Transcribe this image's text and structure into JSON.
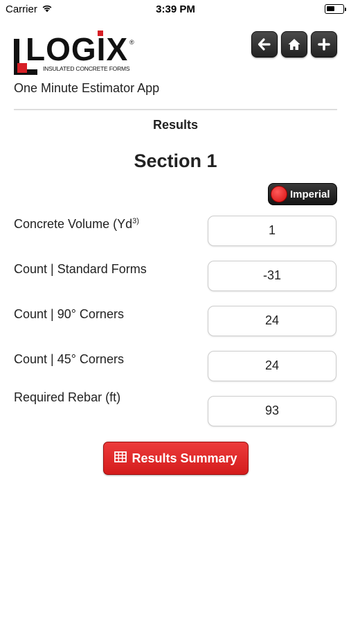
{
  "status_bar": {
    "carrier": "Carrier",
    "time": "3:39 PM"
  },
  "header": {
    "logo_text": "LOGIX",
    "logo_reg": "®",
    "logo_tagline": "INSULATED CONCRETE FORMS",
    "app_name": "One Minute Estimator App",
    "nav_icons": [
      "back-arrow-icon",
      "home-icon",
      "plus-icon"
    ]
  },
  "page": {
    "heading": "Results",
    "section_title": "Section 1"
  },
  "unit_toggle": {
    "label": "Imperial",
    "knob_color": "#e02020"
  },
  "rows": [
    {
      "label": "Concrete Volume (Yd",
      "sup": "3)",
      "value": "1"
    },
    {
      "label": "Count | Standard Forms",
      "value": "-31"
    },
    {
      "label": "Count | 90° Corners",
      "value": "24"
    },
    {
      "label": "Count | 45° Corners",
      "value": "24"
    },
    {
      "label": "Required Rebar (ft)",
      "value": "93"
    }
  ],
  "summary_button": {
    "label": "Results Summary",
    "icon": "table-icon",
    "color": "#e02828"
  }
}
